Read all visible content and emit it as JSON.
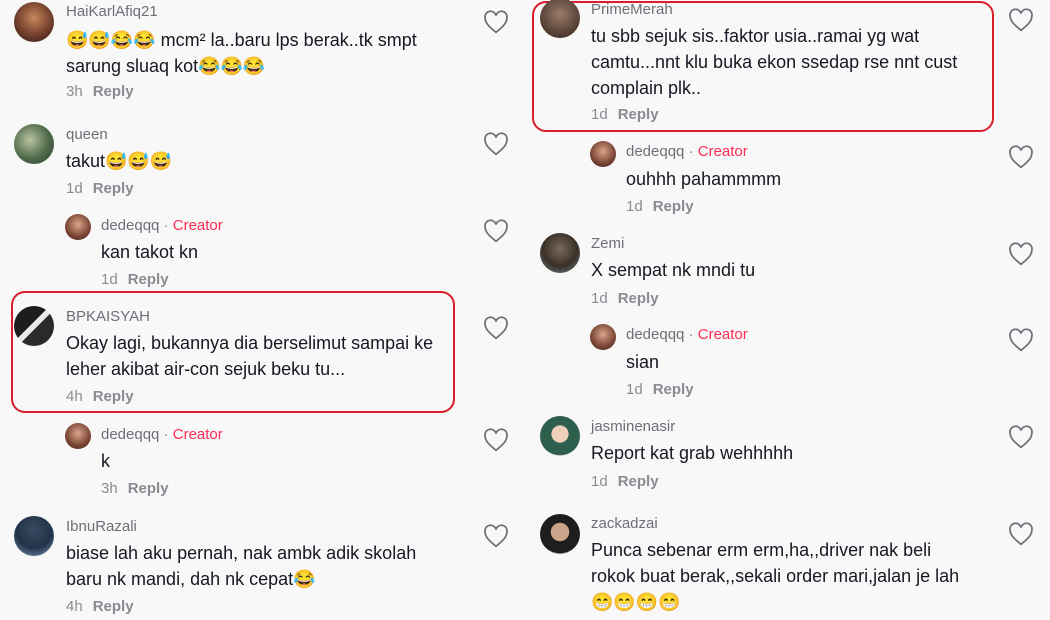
{
  "left": [
    {
      "user": "HaiKarlAfiq21",
      "text": "😅😅😂😂 mcm² la..baru lps berak..tk smpt\nsarung sluaq kot😂😂😂",
      "time": "3h",
      "reply": "Reply"
    },
    {
      "user": "queen",
      "text": "takut😅😅😅",
      "time": "1d",
      "reply": "Reply"
    },
    {
      "user": "dedeqqq",
      "creator": "Creator",
      "text": "kan takot kn",
      "time": "1d",
      "reply": "Reply"
    },
    {
      "user": "BPKAISYAH",
      "text": "Okay lagi, bukannya dia berselimut sampai ke\nleher akibat air-con sejuk beku tu...",
      "time": "4h",
      "reply": "Reply"
    },
    {
      "user": "dedeqqq",
      "creator": "Creator",
      "text": "k",
      "time": "3h",
      "reply": "Reply"
    },
    {
      "user": "IbnuRazali",
      "text": "biase lah aku pernah, nak ambk adik skolah\nbaru nk mandi, dah nk cepat😂",
      "time": "4h",
      "reply": "Reply"
    }
  ],
  "right": [
    {
      "user": "PrimeMerah",
      "text": "tu sbb sejuk sis..faktor usia..ramai yg wat\ncamtu...nnt klu buka ekon ssedap rse nnt cust\ncomplain plk..",
      "time": "1d",
      "reply": "Reply"
    },
    {
      "user": "dedeqqq",
      "creator": "Creator",
      "text": "ouhhh pahammmm",
      "time": "1d",
      "reply": "Reply"
    },
    {
      "user": "Zemi",
      "text": "X sempat nk mndi tu",
      "time": "1d",
      "reply": "Reply"
    },
    {
      "user": "dedeqqq",
      "creator": "Creator",
      "text": "sian",
      "time": "1d",
      "reply": "Reply"
    },
    {
      "user": "jasminenasir",
      "text": "Report kat grab wehhhhh",
      "time": "1d",
      "reply": "Reply"
    },
    {
      "user": "zackadzai",
      "text": "Punca sebenar erm erm,ha,,driver nak beli\nrokok buat berak,,sekali order mari,jalan je lah\n😁😁😁😁",
      "time": "",
      "reply": ""
    }
  ],
  "separator": " · ",
  "colors": {
    "accent": "#fe2c55",
    "highlight": "#d81e2a",
    "text": "#161823",
    "muted": "#8a8a92"
  },
  "icons": {
    "like": "heart-outline-icon"
  }
}
